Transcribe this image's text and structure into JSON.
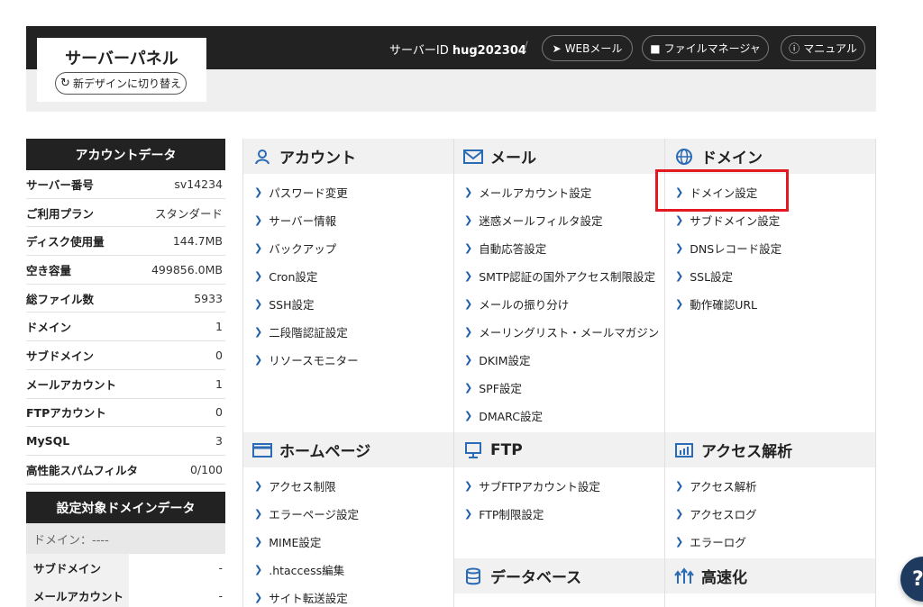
{
  "header": {
    "title": "サーバーパネル",
    "redesign_label": "新デザインに切り替え",
    "server_id_label": "サーバーID",
    "server_id_value": "hug202304",
    "separator": "/",
    "web_mail": "WEBメール",
    "file_manager": "ファイルマネージャ",
    "manual": "マニュアル"
  },
  "account": {
    "title": "アカウントデータ",
    "rows": [
      {
        "label": "サーバー番号",
        "value": "sv14234"
      },
      {
        "label": "ご利用プラン",
        "value": "スタンダード"
      },
      {
        "label": "ディスク使用量",
        "value": "144.7MB"
      },
      {
        "label": "空き容量",
        "value": "499856.0MB"
      },
      {
        "label": "総ファイル数",
        "value": "5933"
      },
      {
        "label": "ドメイン",
        "value": "1"
      },
      {
        "label": "サブドメイン",
        "value": "0"
      },
      {
        "label": "メールアカウント",
        "value": "1"
      },
      {
        "label": "FTPアカウント",
        "value": "0"
      },
      {
        "label": "MySQL",
        "value": "3"
      },
      {
        "label": "高性能スパムフィルタ",
        "value": "0/100"
      }
    ]
  },
  "domain_data": {
    "title": "設定対象ドメインデータ",
    "domain_label": "ドメイン：----",
    "rows": [
      {
        "label": "サブドメイン",
        "value": "-"
      },
      {
        "label": "メールアカウント",
        "value": "-"
      }
    ]
  },
  "sections": {
    "account": {
      "title": "アカウント",
      "items": [
        "パスワード変更",
        "サーバー情報",
        "バックアップ",
        "Cron設定",
        "SSH設定",
        "二段階認証設定",
        "リソースモニター"
      ]
    },
    "mail": {
      "title": "メール",
      "items": [
        "メールアカウント設定",
        "迷惑メールフィルタ設定",
        "自動応答設定",
        "SMTP認証の国外アクセス制限設定",
        "メールの振り分け",
        "メーリングリスト・メールマガジン",
        "DKIM設定",
        "SPF設定",
        "DMARC設定"
      ]
    },
    "domain": {
      "title": "ドメイン",
      "items": [
        "ドメイン設定",
        "サブドメイン設定",
        "DNSレコード設定",
        "SSL設定",
        "動作確認URL"
      ]
    },
    "homepage": {
      "title": "ホームページ",
      "items": [
        "アクセス制限",
        "エラーページ設定",
        "MIME設定",
        ".htaccess編集",
        "サイト転送設定"
      ]
    },
    "ftp": {
      "title": "FTP",
      "items": [
        "サブFTPアカウント設定",
        "FTP制限設定"
      ]
    },
    "analytics": {
      "title": "アクセス解析",
      "items": [
        "アクセス解析",
        "アクセスログ",
        "エラーログ"
      ]
    },
    "database": {
      "title": "データベース"
    },
    "speed": {
      "title": "高速化"
    }
  },
  "help": {
    "label": "?"
  },
  "colors": {
    "header_bg": "#222222",
    "accent_blue": "#1f5fa8",
    "highlight_red": "#e4181f"
  }
}
